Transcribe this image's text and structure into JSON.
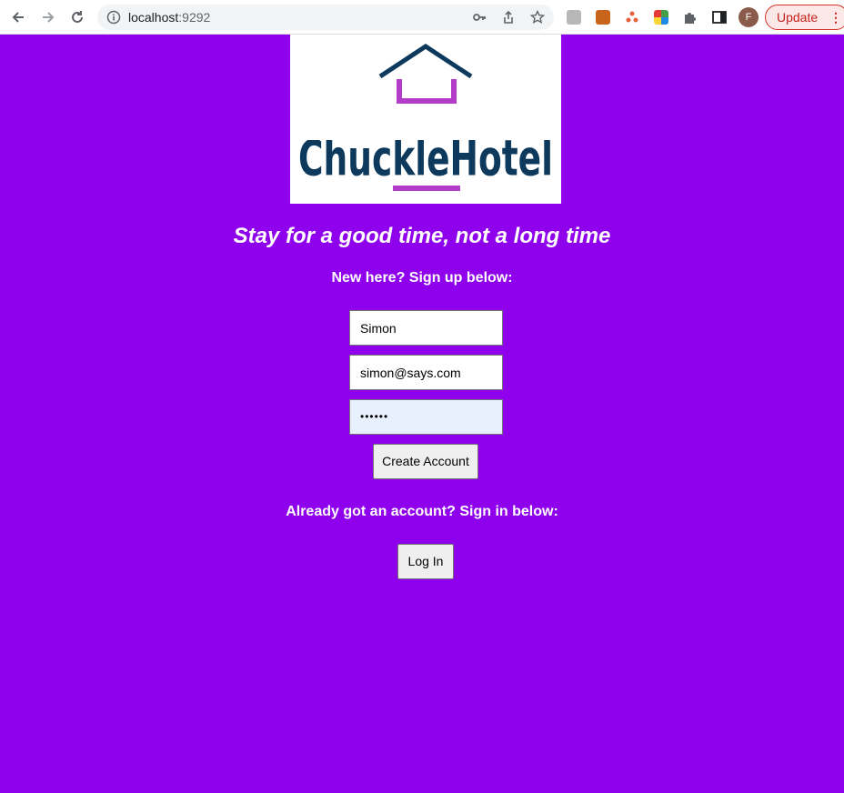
{
  "browser": {
    "url_host": "localhost",
    "url_port": ":9292",
    "profile_initial": "F",
    "update_label": "Update"
  },
  "logo": {
    "brand_text": "ChuckleHotel"
  },
  "page": {
    "tagline": "Stay for a good time, not a long time",
    "signup_heading": "New here? Sign up below:",
    "name_value": "Simon",
    "email_value": "simon@says.com",
    "password_value": "••••••",
    "create_account_label": "Create Account",
    "signin_heading": "Already got an account? Sign in below:",
    "login_label": "Log In"
  },
  "colors": {
    "page_background": "#8f00ec",
    "logo_navy": "#0d3a5c",
    "logo_purple": "#b33cc8"
  }
}
